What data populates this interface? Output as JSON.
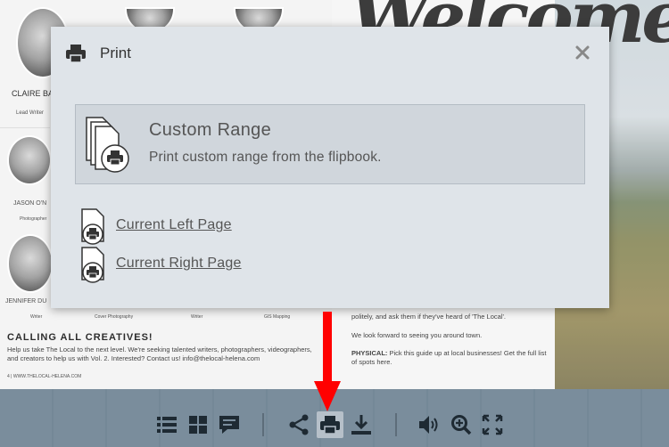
{
  "background": {
    "welcome_text": "Welcome",
    "team": [
      {
        "name": "CLAIRE BA",
        "role": "Lead Writer"
      },
      {
        "name": "JASON O'N",
        "role": "Photographer"
      },
      {
        "name": "JENNIFER DU",
        "role": "Writer"
      }
    ],
    "bottom_roles": [
      "Writer",
      "Cover Photography",
      "Writer",
      "GIS Mapping"
    ],
    "callout_title": "CALLING ALL CREATIVES!",
    "callout_body": "Help us take The Local to the next level. We're seeking talented writers, photographers, videographers, and creators to help us with Vol. 2. Interested? Contact us! info@thelocal-helena.com",
    "footer": "4 | WWW.THELOCAL-HELENA.COM",
    "right_para1": "politely, and ask them if they've heard of 'The Local'.",
    "right_para2": "We look forward to seeing you around town.",
    "right_para3_label": "PHYSICAL:",
    "right_para3": "Pick this guide up at local businesses! Get the full list of spots here."
  },
  "dialog": {
    "title": "Print",
    "close_icon": "close-icon",
    "custom_range": {
      "title": "Custom Range",
      "description": "Print custom range from the flipbook."
    },
    "options": [
      {
        "label": "Current Left Page"
      },
      {
        "label": "Current Right Page"
      }
    ]
  },
  "toolbar": {
    "buttons": [
      {
        "icon": "list-icon",
        "active": false
      },
      {
        "icon": "grid-icon",
        "active": false
      },
      {
        "icon": "comment-icon",
        "active": false
      },
      {
        "icon": "share-icon",
        "active": false
      },
      {
        "icon": "print-icon",
        "active": true
      },
      {
        "icon": "download-icon",
        "active": false
      },
      {
        "icon": "volume-icon",
        "active": false
      },
      {
        "icon": "zoom-in-icon",
        "active": false
      },
      {
        "icon": "fullscreen-icon",
        "active": false
      }
    ]
  },
  "colors": {
    "dialog_bg": "#dfe4e9",
    "highlight_bg": "#d0d6dc",
    "toolbar_bg": "#7a8d9c",
    "arrow": "#ff0000"
  }
}
